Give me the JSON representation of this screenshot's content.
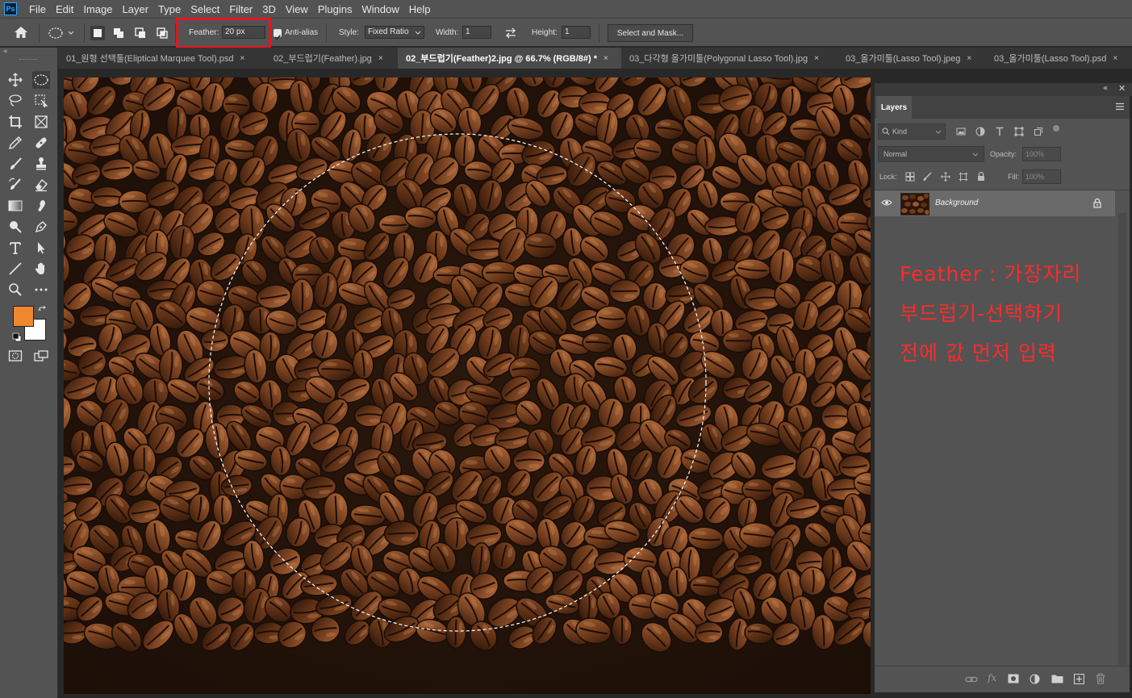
{
  "app": {
    "logo": "Ps"
  },
  "menu": [
    "File",
    "Edit",
    "Image",
    "Layer",
    "Type",
    "Select",
    "Filter",
    "3D",
    "View",
    "Plugins",
    "Window",
    "Help"
  ],
  "options": {
    "feather_label": "Feather:",
    "feather_value": "20 px",
    "antialias_label": "Anti-alias",
    "antialias_checked": true,
    "style_label": "Style:",
    "style_value": "Fixed Ratio",
    "width_label": "Width:",
    "width_value": "1",
    "height_label": "Height:",
    "height_value": "1",
    "select_mask_label": "Select and Mask...",
    "highlight_color": "#e8141e"
  },
  "tabs": [
    {
      "label": "01_원형 선택툴(Eliptical Marquee Tool).psd",
      "close": "×",
      "active": false
    },
    {
      "label": "02_부드럽기(Feather).jpg",
      "close": "×",
      "active": false
    },
    {
      "label": "02_부드럽기(Feather)2.jpg @ 66.7% (RGB/8#) *",
      "close": "×",
      "active": true
    },
    {
      "label": "03_다각형 올가미툴(Polygonal Lasso Tool).jpg",
      "close": "×",
      "active": false
    },
    {
      "label": "03_올가미툴(Lasso Tool).jpeg",
      "close": "×",
      "active": false
    },
    {
      "label": "03_올가미툴(Lasso Tool).psd",
      "close": "×",
      "active": false
    }
  ],
  "colors": {
    "foreground": "#f0862e",
    "background": "#ffffff",
    "annotation": "#ff2a2a"
  },
  "layers_panel": {
    "title": "Layers",
    "kind_label": "Kind",
    "blend_mode": "Normal",
    "opacity_label": "Opacity:",
    "opacity_value": "100%",
    "lock_label": "Lock:",
    "fill_label": "Fill:",
    "fill_value": "100%",
    "layers": [
      {
        "name": "Background",
        "visible": true,
        "locked": true
      }
    ]
  },
  "annotation": {
    "lines": [
      "Feather : 가장자리",
      "부드럽기-선택하기",
      "전에 값 먼저 입력"
    ]
  }
}
